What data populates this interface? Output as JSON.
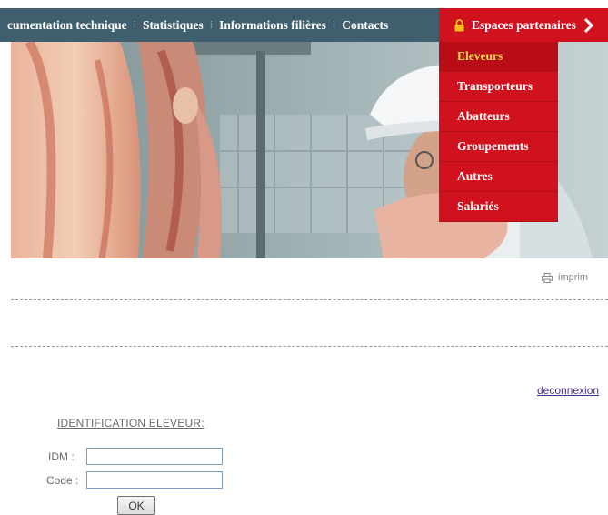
{
  "nav": {
    "items": [
      "cumentation technique",
      "Statistiques",
      "Informations filières",
      "Contacts"
    ],
    "separator": "⁞",
    "partner_label": "Espaces partenaires",
    "partner_icon": "lock-icon",
    "chevron_icon": "chevron-right-icon"
  },
  "dropdown": {
    "items": [
      "Eleveurs",
      "Transporteurs",
      "Abatteurs",
      "Groupements",
      "Autres",
      "Salariés"
    ],
    "active_index": 0
  },
  "print": {
    "label": "imprim",
    "icon": "printer-icon"
  },
  "logout": {
    "label": "deconnexion"
  },
  "form": {
    "title": "IDENTIFICATION ELEVEUR:",
    "idm_label": "IDM :",
    "idm_value": "",
    "code_label": "Code :",
    "code_value": "",
    "submit_label": "OK"
  },
  "colors": {
    "nav_bg": "#3f5f6f",
    "partner_red": "#d0121e",
    "active_item_text": "#f2df4a",
    "link_purple": "#4a2f8c"
  }
}
